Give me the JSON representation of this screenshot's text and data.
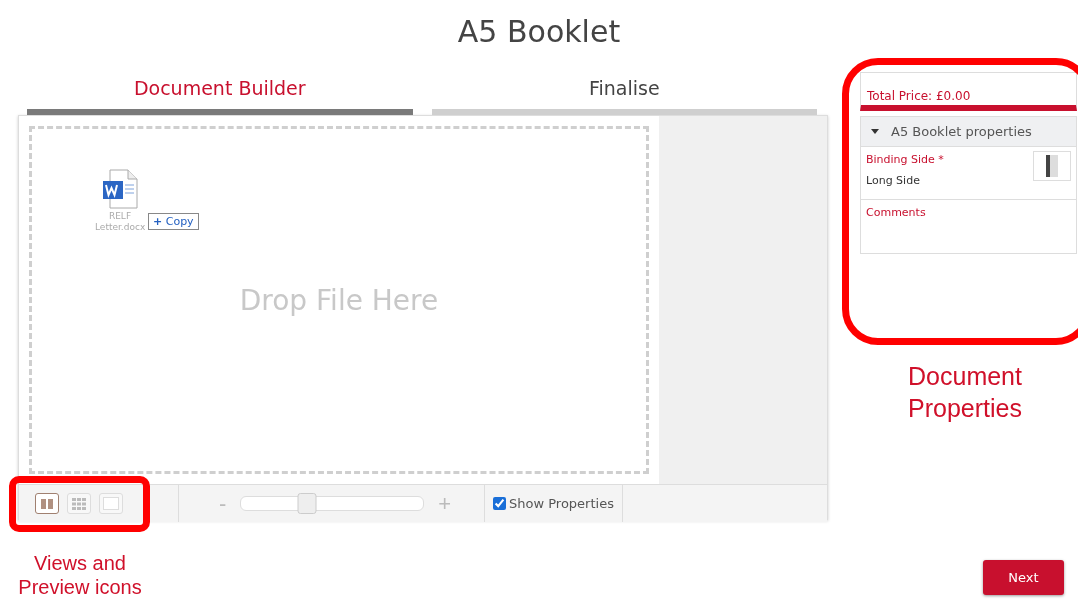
{
  "title": "A5 Booklet",
  "tabs": [
    {
      "label": "Document Builder",
      "selected": true
    },
    {
      "label": "Finalise",
      "selected": false
    }
  ],
  "canvas": {
    "file": {
      "name": "RELF Letter.docx",
      "badge": "Copy",
      "badge_icon": "+"
    },
    "drop_hint": "Drop File Here"
  },
  "toolbar": {
    "views": [
      {
        "selected": true
      },
      {
        "selected": false
      },
      {
        "selected": false
      }
    ],
    "zoom_out": "-",
    "zoom_in": "+",
    "zoom": {
      "level": 0.36
    },
    "show_properties": {
      "label": "Show Properties",
      "checked": true
    }
  },
  "properties": {
    "total_price": "Total Price: £0.00",
    "section": {
      "label": "A5 Booklet properties",
      "expanded": true
    },
    "binding": {
      "label": "Binding Side",
      "required": "*",
      "value": "Long Side"
    },
    "comments": {
      "label": "Comments"
    }
  },
  "annotations": [
    {
      "text": "Document Properties"
    },
    {
      "text": "Views and Preview icons"
    }
  ],
  "next_button": "Next"
}
